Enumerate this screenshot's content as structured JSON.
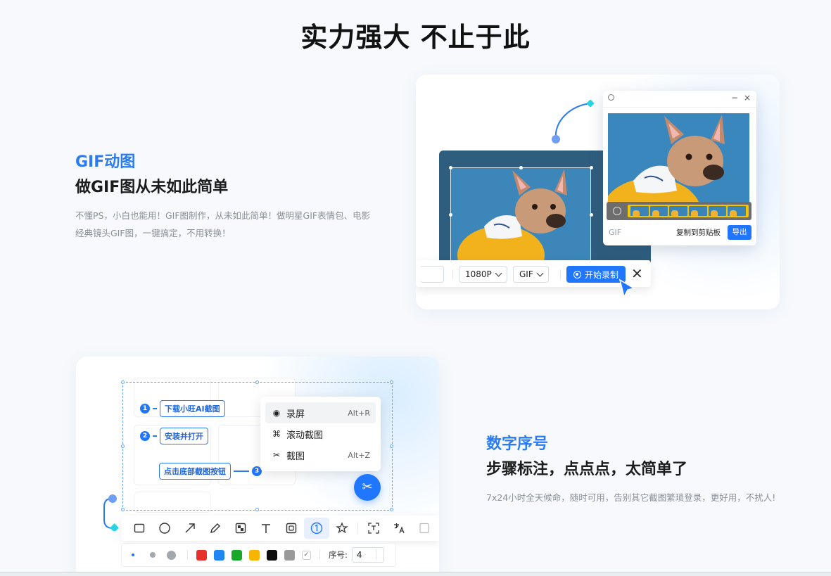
{
  "page": {
    "title": "实力强大 不止于此"
  },
  "section1": {
    "accent_title": "GIF动图",
    "headline": "做GIF图从未如此简单",
    "description": "不懂PS，小白也能用！GIF图制作，从未如此简单！做明星GIF表情包、电影经典镜头GIF图，一键搞定，不用转换！",
    "recorder": {
      "resolution": "1080P",
      "format": "GIF",
      "record_button": "开始录制",
      "close_symbol": "✕"
    },
    "gif_window": {
      "format_label": "GIF",
      "copy_button": "复制到剪贴板",
      "export_button": "导出",
      "minimize_symbol": "−",
      "close_symbol": "×"
    }
  },
  "section2": {
    "accent_title": "数字序号",
    "headline": "步骤标注，点点点，太简单了",
    "description": "7x24小时全天候命，随时可用，告别其它截图繁琐登录，更好用，不扰人!",
    "steps": [
      {
        "num": "1",
        "label": "下载小旺AI截图"
      },
      {
        "num": "2",
        "label": "安装并打开"
      },
      {
        "num": "3",
        "label": "点击底部截图按钮"
      }
    ],
    "menu": [
      {
        "icon": "record-icon",
        "label": "录屏",
        "shortcut": "Alt+R"
      },
      {
        "icon": "scroll-capture-icon",
        "label": "滚动截图",
        "shortcut": ""
      },
      {
        "icon": "scissors-icon",
        "label": "截图",
        "shortcut": "Alt+Z"
      }
    ],
    "toolbar_icons": [
      "rectangle-icon",
      "ellipse-icon",
      "arrow-icon",
      "pen-icon",
      "mosaic-icon",
      "text-icon",
      "eraser-icon",
      "number-icon",
      "magic-icon",
      "ocr-icon",
      "translate-icon",
      "more-icon"
    ],
    "colors": [
      "#e8312a",
      "#1f86f2",
      "#1aa82a",
      "#f7b500",
      "#0d0d0d",
      "#9a9a9a"
    ],
    "seq_label": "序号:",
    "seq_value": "4"
  },
  "theme": {
    "accent": "#2b7bf3",
    "primary_button": "#2176ff"
  }
}
